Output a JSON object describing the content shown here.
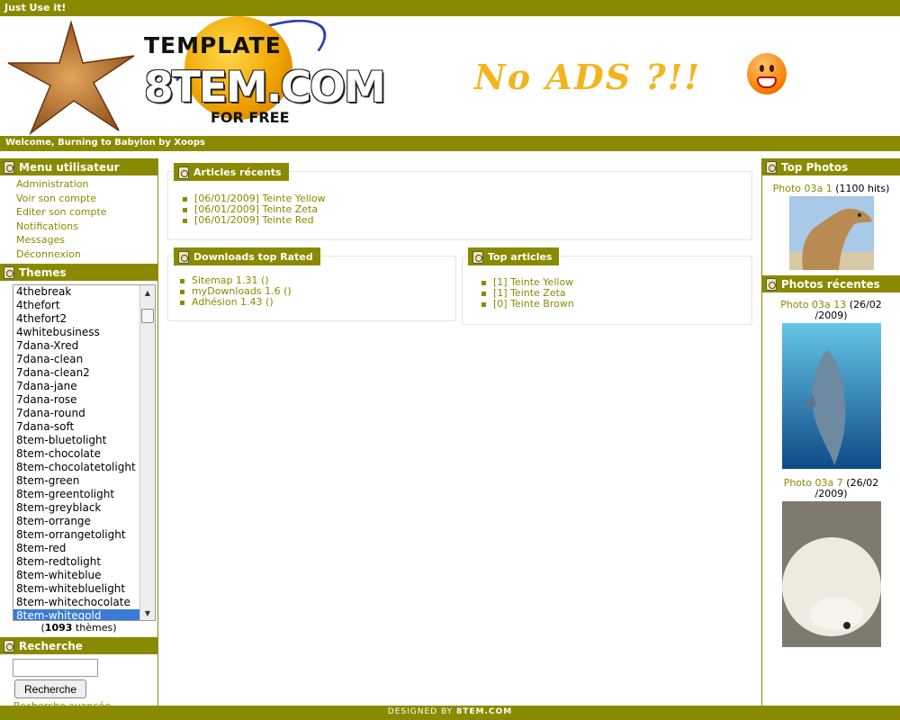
{
  "topbar": {
    "text": "Just Use it!"
  },
  "logo": {
    "template": "TEMPLATE",
    "main": "8TEM.COM",
    "forfree": "FOR FREE"
  },
  "banner": {
    "text": "No ADS ?!!"
  },
  "welcome": {
    "text": "Welcome, Burning to Babylon by Xoops"
  },
  "user_menu": {
    "title": "Menu utilisateur",
    "items": [
      "Administration",
      "Voir son compte",
      "Editer son compte",
      "Notifications",
      "Messages",
      "Déconnexion"
    ]
  },
  "themes": {
    "title": "Themes",
    "items": [
      "4thebreak",
      "4thefort",
      "4thefort2",
      "4whitebusiness",
      "7dana-Xred",
      "7dana-clean",
      "7dana-clean2",
      "7dana-jane",
      "7dana-rose",
      "7dana-round",
      "7dana-soft",
      "8tem-bluetolight",
      "8tem-chocolate",
      "8tem-chocolatetolight",
      "8tem-green",
      "8tem-greentolight",
      "8tem-greyblack",
      "8tem-orrange",
      "8tem-orrangetolight",
      "8tem-red",
      "8tem-redtolight",
      "8tem-whiteblue",
      "8tem-whitebluelight",
      "8tem-whitechocolate",
      "8tem-whitegold"
    ],
    "selected": "8tem-whitegold",
    "count": "1093",
    "count_suffix": "thèmes"
  },
  "search": {
    "title": "Recherche",
    "button": "Recherche",
    "advanced": "Recherche avancée"
  },
  "recent_articles": {
    "title": "Articles récents",
    "items": [
      "[06/01/2009] Teinte Yellow",
      "[06/01/2009] Teinte Zeta",
      "[06/01/2009] Teinte Red"
    ]
  },
  "downloads": {
    "title": "Downloads top Rated",
    "items": [
      "Sitemap 1.31 ()",
      "myDownloads 1.6 ()",
      "Adhésion 1.43 ()"
    ]
  },
  "top_articles": {
    "title": "Top articles",
    "items": [
      "[1] Teinte Yellow",
      "[1] Teinte Zeta",
      "[0] Teinte Brown"
    ]
  },
  "top_photos": {
    "title": "Top Photos",
    "photo1_link": "Photo 03a 1",
    "photo1_hits": "(1100 hits)"
  },
  "recent_photos": {
    "title": "Photos récentes",
    "photo1_link": "Photo 03a 13",
    "photo1_date_a": "(26/02",
    "photo1_date_b": "/2009)",
    "photo2_link": "Photo 03a 7",
    "photo2_date_a": "(26/02",
    "photo2_date_b": "/2009)"
  },
  "footer": {
    "prefix": "DESIGNED BY",
    "brand": "8TEM.COM"
  },
  "colors": {
    "accent": "#8a8a00",
    "selection": "#3a7bd5"
  }
}
